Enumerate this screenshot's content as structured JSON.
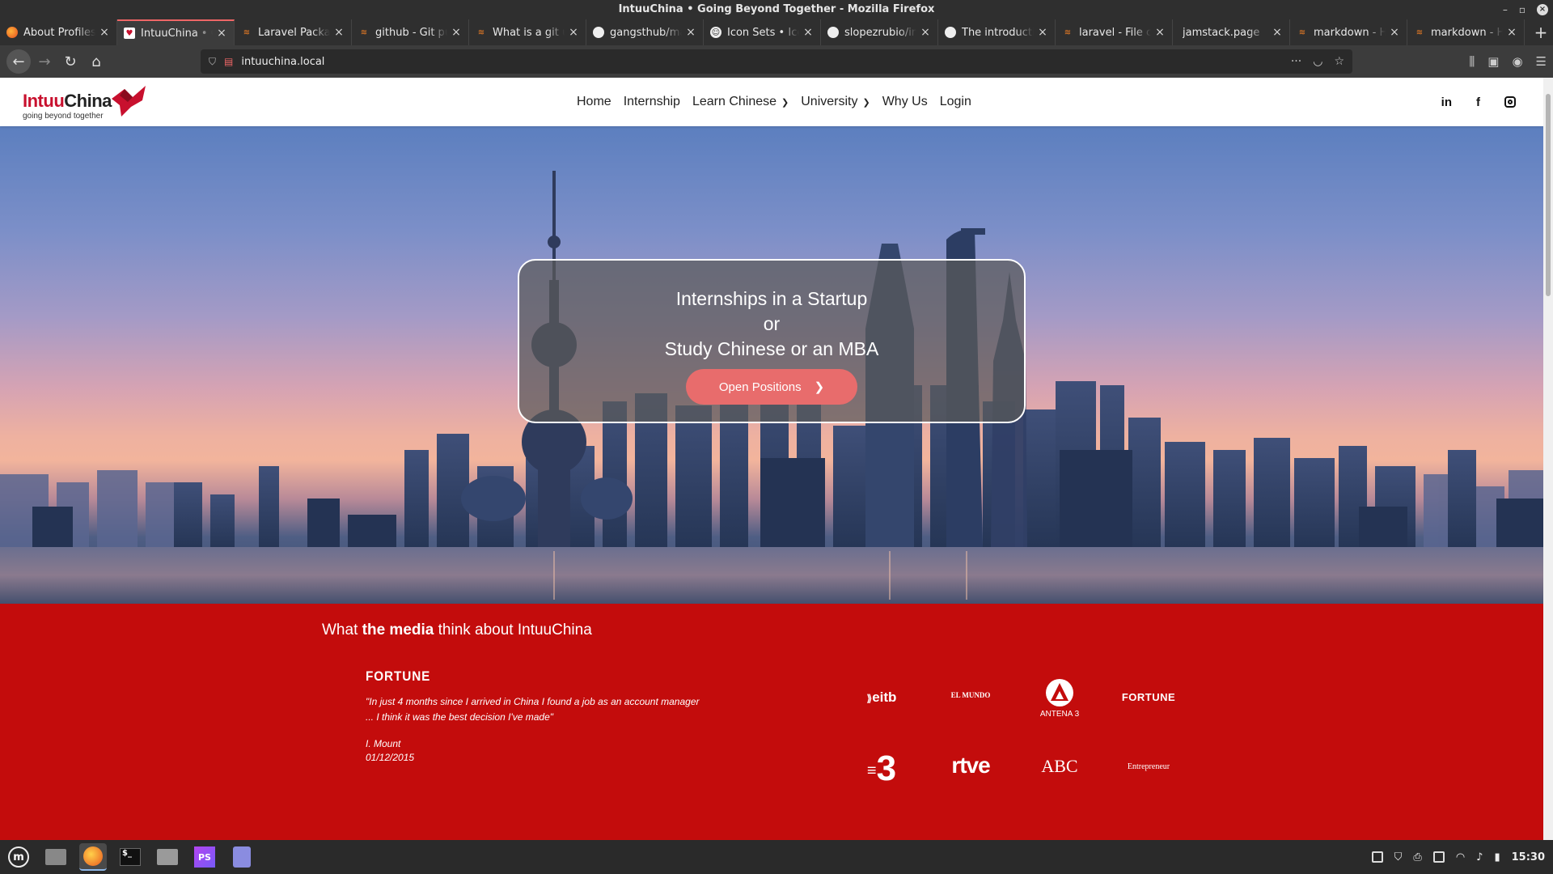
{
  "window": {
    "title": "IntuuChina • Going Beyond Together - Mozilla Firefox"
  },
  "tabs": [
    {
      "label": "About Profiles",
      "favicon": "firefox-icon",
      "active": false
    },
    {
      "label": "IntuuChina • Going Beyond Together",
      "favicon": "intuuchina-icon",
      "active": true
    },
    {
      "label": "Laravel Package",
      "favicon": "stackoverflow-icon",
      "active": false
    },
    {
      "label": "github - Git push",
      "favicon": "stackoverflow-icon",
      "active": false
    },
    {
      "label": "What is a git upstream",
      "favicon": "stackoverflow-icon",
      "active": false
    },
    {
      "label": "gangsthub/markdown",
      "favicon": "github-icon",
      "active": false
    },
    {
      "label": "Icon Sets • Iconify",
      "favicon": "iconify-icon",
      "active": false
    },
    {
      "label": "slopezrubio/intuuchina",
      "favicon": "github-icon",
      "active": false
    },
    {
      "label": "The introduction",
      "favicon": "github-icon",
      "active": false
    },
    {
      "label": "laravel - File cannot",
      "favicon": "stackoverflow-icon",
      "active": false
    },
    {
      "label": "jamstack.page",
      "favicon": "",
      "active": false
    },
    {
      "label": "markdown - How",
      "favicon": "stackoverflow-icon",
      "active": false
    },
    {
      "label": "markdown - How",
      "favicon": "stackoverflow-icon",
      "active": false
    }
  ],
  "url": "intuuchina.local",
  "site": {
    "logo": {
      "name_part1": "Intuu",
      "name_part2": "China",
      "tagline": "going beyond together"
    },
    "nav": [
      {
        "label": "Home",
        "has_chevron": false
      },
      {
        "label": "Internship",
        "has_chevron": false
      },
      {
        "label": "Learn Chinese",
        "has_chevron": true
      },
      {
        "label": "University",
        "has_chevron": true
      },
      {
        "label": "Why Us",
        "has_chevron": false
      },
      {
        "label": "Login",
        "has_chevron": false
      }
    ],
    "social": [
      "linkedin-icon",
      "facebook-icon",
      "instagram-icon"
    ],
    "social_text": {
      "linkedin": "in",
      "facebook": "f"
    },
    "hero": {
      "line1": "Internships in a Startup",
      "line2": "or",
      "line3": "Study Chinese or an MBA",
      "button_label": "Open Positions",
      "button_color": "#e86c6c"
    },
    "media": {
      "title_pre": "What",
      "title_bold": "the media",
      "title_post": "think about IntuuChina",
      "background": "#c30c0c",
      "quote": {
        "source": "FORTUNE",
        "text": "\"In just 4 months since I arrived in China I found a job as an account manager ... I think it was the best decision I've made\"",
        "author": "I. Mount",
        "date": "01/12/2015"
      },
      "logos": {
        "eitb": "eitb",
        "elmundo": "EL MUNDO",
        "antena3": "ANTENA 3",
        "fortune": "FORTUNE",
        "tv3": "3",
        "rtve": "rtve",
        "abc": "ABC",
        "entrepreneur": "Entrepreneur"
      }
    }
  },
  "taskbar": {
    "apps": [
      "mint-menu-icon",
      "show-desktop-icon",
      "firefox-icon",
      "terminal-icon",
      "files-icon",
      "phpstorm-icon",
      "text-editor-icon"
    ],
    "clock": "15:30",
    "phpstorm_label": "PS"
  }
}
